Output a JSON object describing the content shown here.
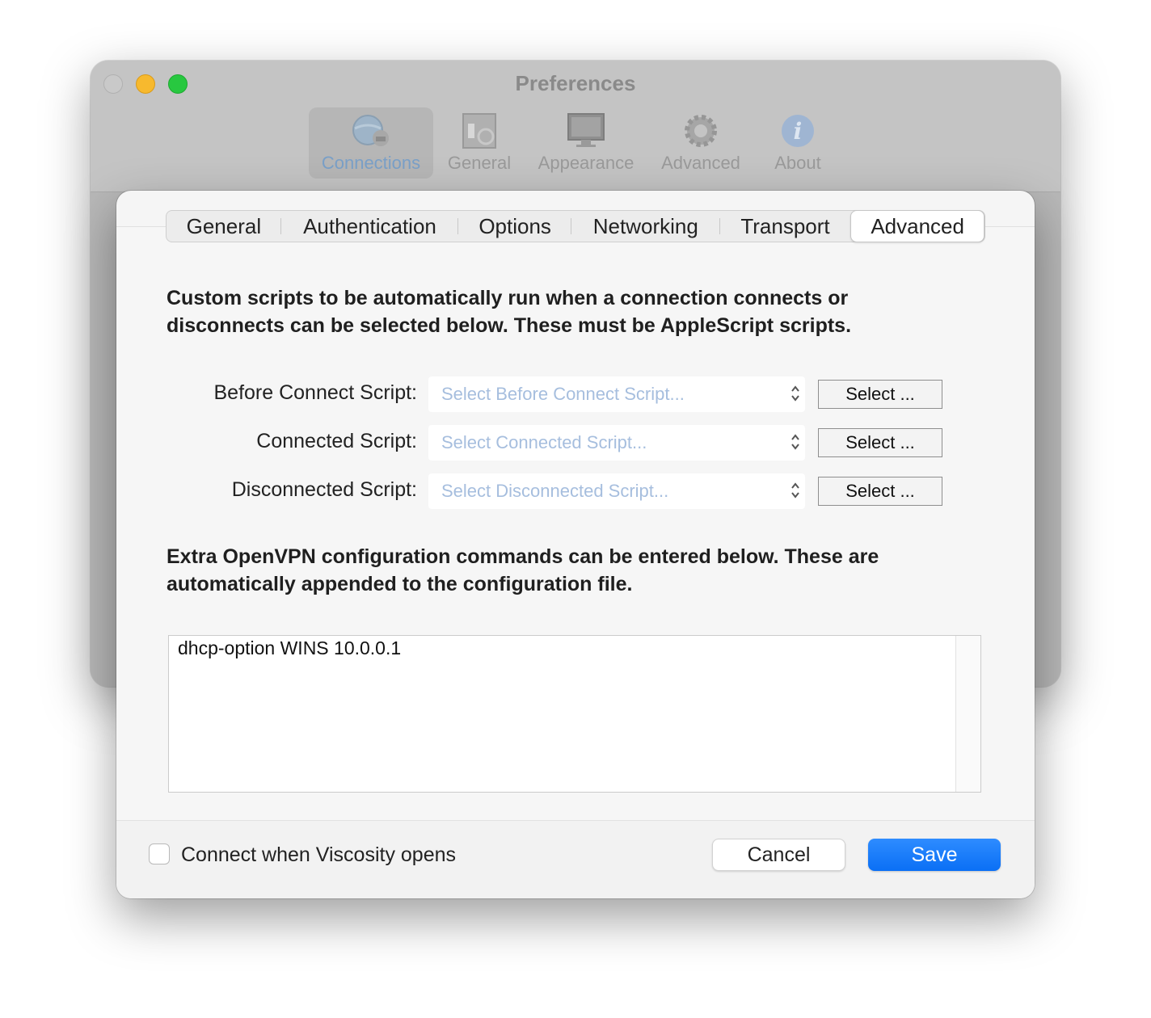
{
  "window": {
    "title": "Preferences",
    "toolbar": [
      {
        "label": "Connections",
        "icon": "connections-globe-icon",
        "active": true
      },
      {
        "label": "General",
        "icon": "general-switch-icon",
        "active": false
      },
      {
        "label": "Appearance",
        "icon": "appearance-monitor-icon",
        "active": false
      },
      {
        "label": "Advanced",
        "icon": "advanced-gear-icon",
        "active": false
      },
      {
        "label": "About",
        "icon": "about-info-icon",
        "active": false
      }
    ]
  },
  "sheet": {
    "tabs": [
      {
        "label": "General",
        "active": false
      },
      {
        "label": "Authentication",
        "active": false
      },
      {
        "label": "Options",
        "active": false
      },
      {
        "label": "Networking",
        "active": false
      },
      {
        "label": "Transport",
        "active": false
      },
      {
        "label": "Advanced",
        "active": true
      }
    ],
    "scripts_description_line1": "Custom scripts to be automatically run when a connection connects or",
    "scripts_description_line2": "disconnects can be selected below. These must be AppleScript scripts.",
    "scripts": [
      {
        "label": "Before Connect Script:",
        "placeholder": "Select Before Connect Script...",
        "button": "Select ..."
      },
      {
        "label": "Connected Script:",
        "placeholder": "Select Connected Script...",
        "button": "Select ..."
      },
      {
        "label": "Disconnected Script:",
        "placeholder": "Select Disconnected Script...",
        "button": "Select ..."
      }
    ],
    "config_description_line1": "Extra OpenVPN configuration commands can be entered below. These are",
    "config_description_line2": "automatically appended to the configuration file.",
    "config_text": "dhcp-option WINS 10.0.0.1",
    "footer": {
      "checkbox_label": "Connect when Viscosity opens",
      "checkbox_checked": false,
      "cancel_label": "Cancel",
      "save_label": "Save"
    }
  },
  "colors": {
    "accent": "#0a6ff5",
    "placeholder": "#a6bede",
    "traffic_close": "#c9c9c9",
    "traffic_minimize": "#f7b92e",
    "traffic_maximize": "#28c840"
  }
}
